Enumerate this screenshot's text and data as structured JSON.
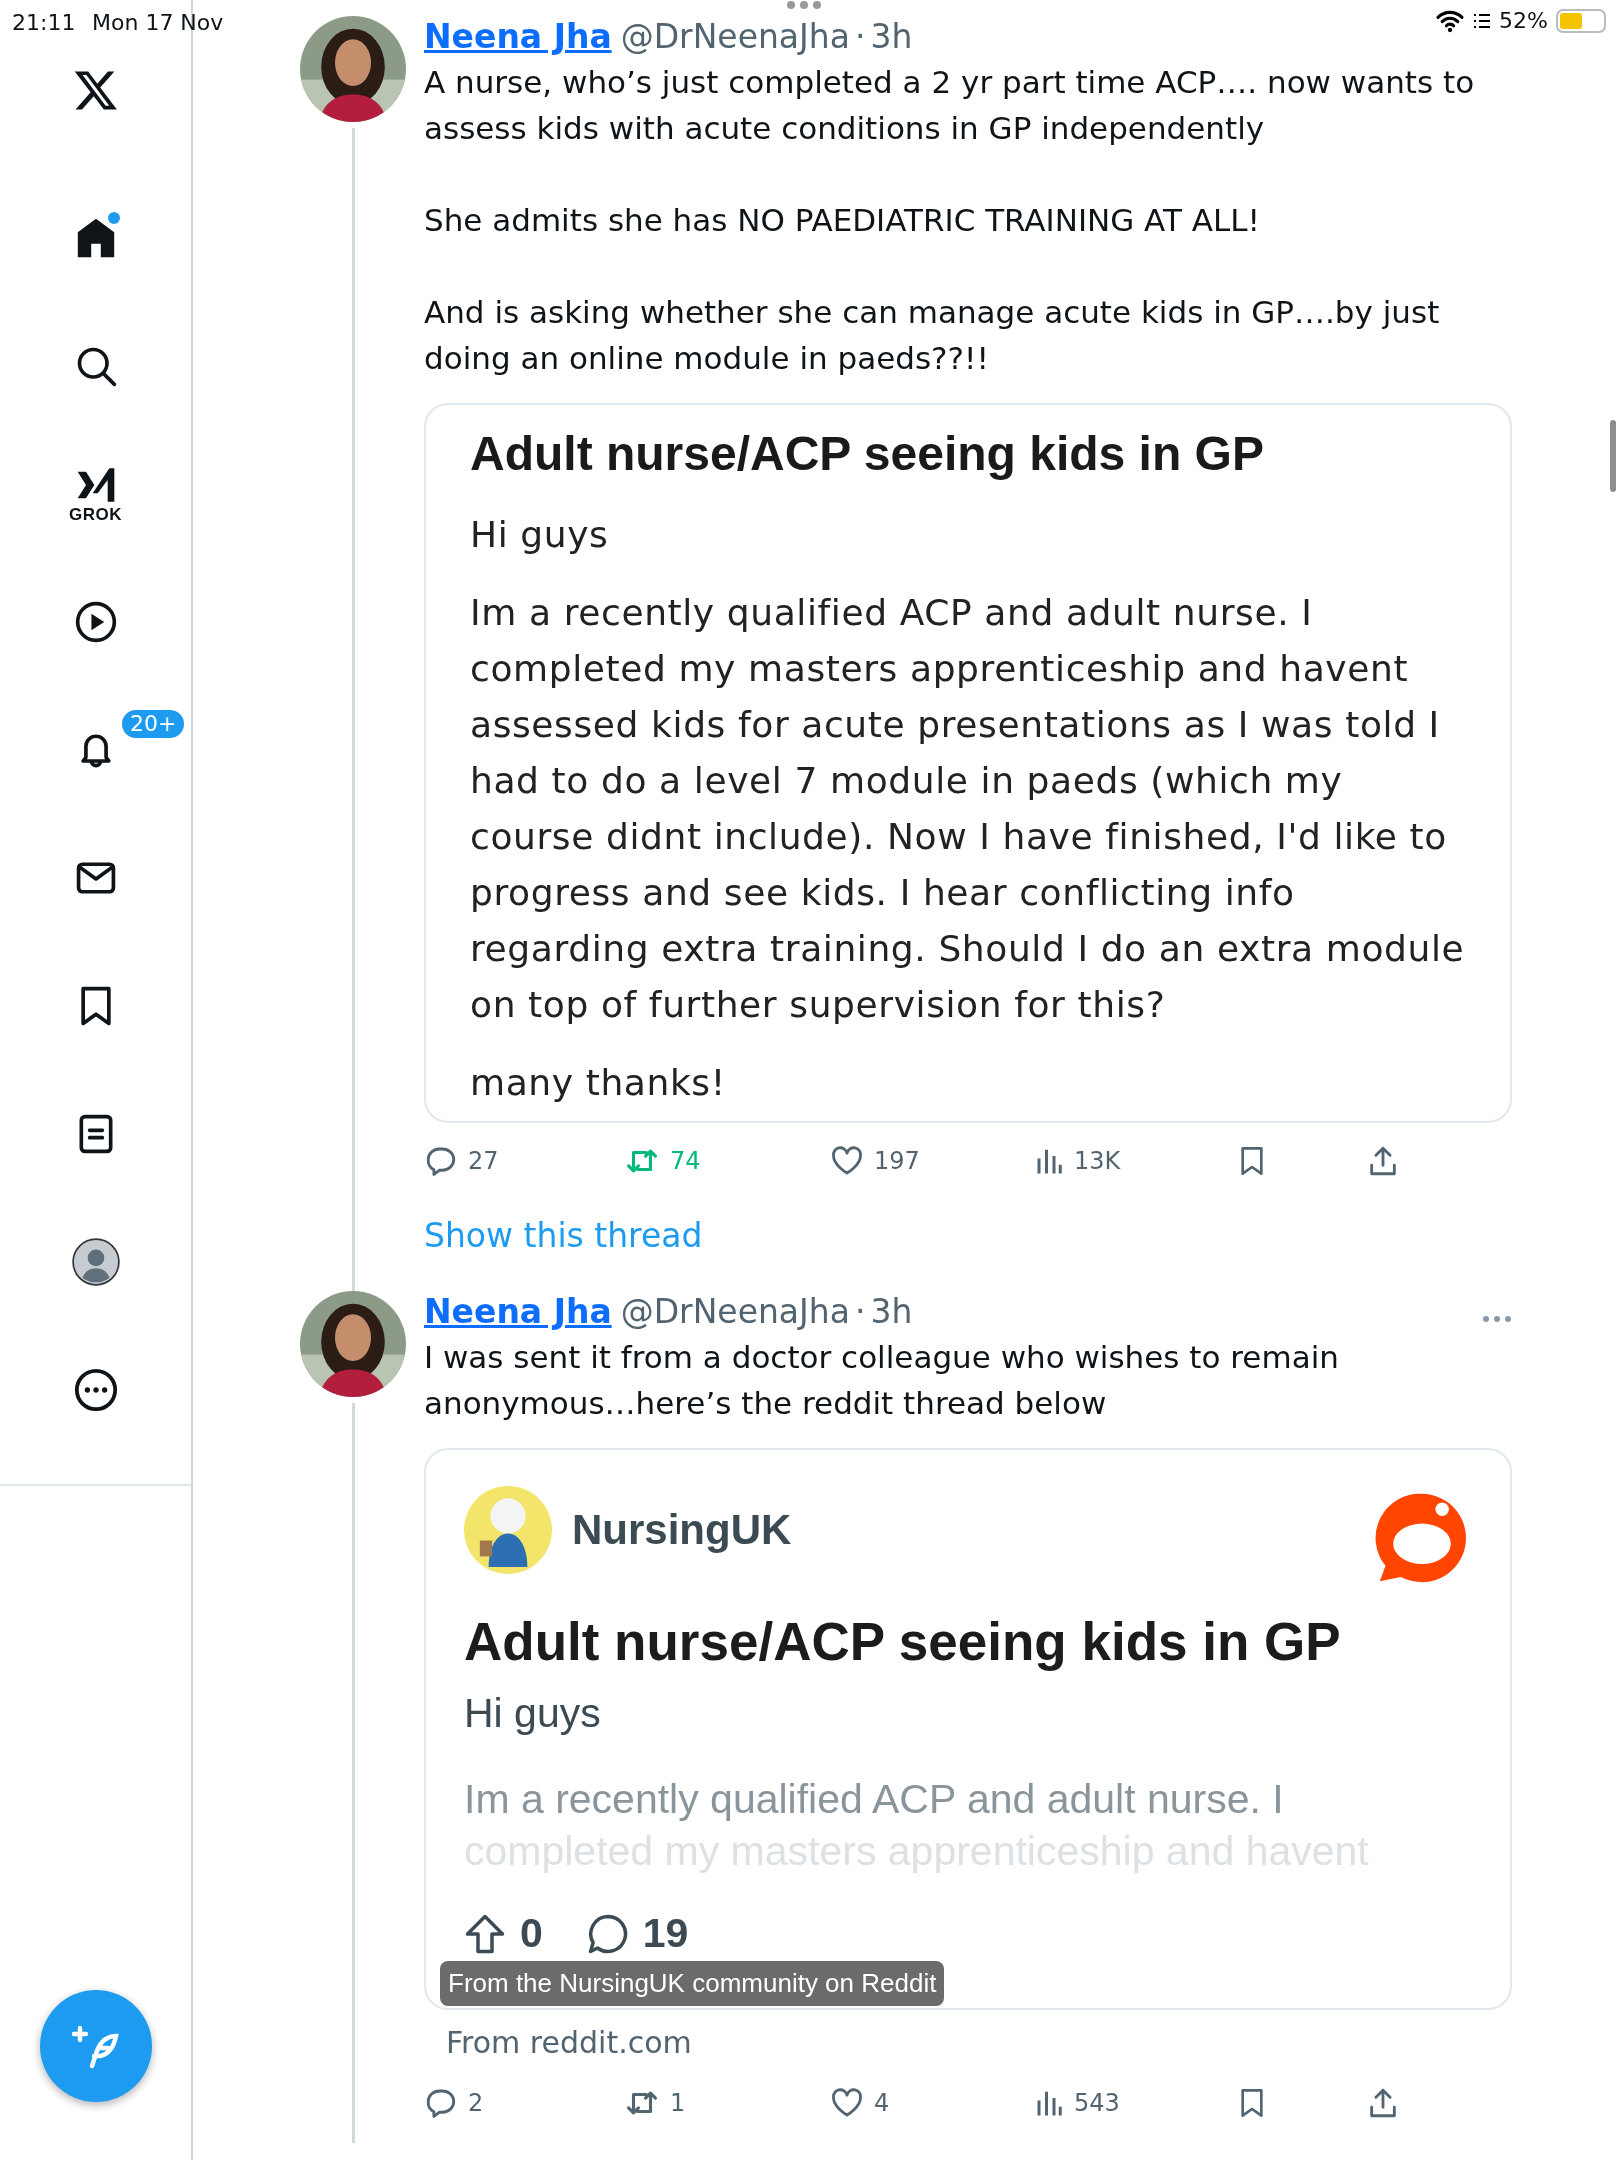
{
  "status_bar": {
    "time": "21:11",
    "date": "Mon 17 Nov",
    "battery": "52%"
  },
  "sidebar": {
    "items": [
      {
        "kind": "logo"
      },
      {
        "kind": "home",
        "dot": true
      },
      {
        "kind": "search"
      },
      {
        "kind": "grok",
        "label": "GROK"
      },
      {
        "kind": "video"
      },
      {
        "kind": "notifications",
        "badge": "20+"
      },
      {
        "kind": "messages"
      },
      {
        "kind": "bookmarks"
      },
      {
        "kind": "lists"
      },
      {
        "kind": "profile"
      },
      {
        "kind": "more"
      }
    ]
  },
  "tweets": [
    {
      "name": "Neena Jha",
      "handle": "@DrNeenaJha",
      "separator": "·",
      "time": "3h",
      "more": false,
      "paragraphs": [
        "A nurse, who’s just completed a 2 yr part time ACP…. now wants to assess kids with acute conditions in GP independently",
        "She admits she has NO PAEDIATRIC TRAINING AT ALL!",
        "And is asking whether she can manage acute kids in GP….by just doing an online module in paeds??!!"
      ],
      "card": {
        "kind": "post",
        "title": "Adult nurse/ACP seeing kids in GP",
        "paragraphs": [
          "Hi guys",
          "Im a recently qualified ACP and adult nurse. I completed my masters apprenticeship and havent assessed kids for acute presentations as I was told I had to do a level 7 module in paeds (which my course didnt include). Now I have finished, I'd like to progress and see kids. I hear conflicting info regarding extra training. Should I do an extra module on top of further supervision for this?",
          "many thanks!"
        ]
      },
      "actions": [
        {
          "kind": "reply",
          "count": "27",
          "active": false
        },
        {
          "kind": "repost",
          "count": "74",
          "active": true
        },
        {
          "kind": "like",
          "count": "197",
          "active": false
        },
        {
          "kind": "views",
          "count": "13K",
          "active": false
        },
        {
          "kind": "bookmark",
          "active": false
        },
        {
          "kind": "share"
        }
      ],
      "show_thread": "Show this thread"
    },
    {
      "name": "Neena Jha",
      "handle": "@DrNeenaJha",
      "separator": "·",
      "time": "3h",
      "more": true,
      "paragraphs": [
        "I was sent it from a doctor colleague who wishes to remain anonymous…here’s the reddit thread below"
      ],
      "card": {
        "kind": "link",
        "community": "NursingUK",
        "title": "Adult nurse/ACP seeing kids in GP",
        "intro": "Hi guys",
        "preview": [
          "Im a recently qualified ACP and adult nurse. I",
          "completed my masters apprenticeship and havent"
        ],
        "upvotes": "0",
        "comments": "19",
        "tooltip": "From the NursingUK community on Reddit",
        "source": "From reddit.com"
      },
      "actions": [
        {
          "kind": "reply",
          "count": "2",
          "active": false
        },
        {
          "kind": "repost",
          "count": "1",
          "active": false
        },
        {
          "kind": "like",
          "count": "4",
          "active": false
        },
        {
          "kind": "views",
          "count": "543",
          "active": false
        },
        {
          "kind": "bookmark",
          "active": false
        },
        {
          "kind": "share"
        }
      ]
    }
  ]
}
